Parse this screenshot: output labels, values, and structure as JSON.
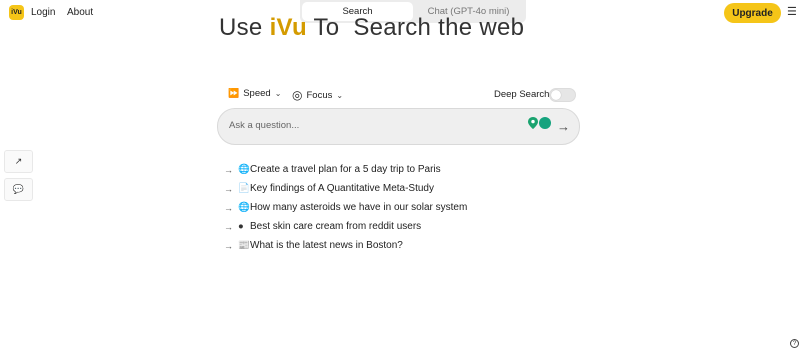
{
  "header": {
    "logo_text": "iVu",
    "nav": [
      "Login",
      "About"
    ],
    "upgrade_label": "Upgrade",
    "menu_icon": "hamburger-icon"
  },
  "tabs": [
    {
      "label": "Search",
      "active": true
    },
    {
      "label": "Chat (GPT-4o mini)",
      "active": false
    }
  ],
  "headline": {
    "prefix": "Use ",
    "brand": "iVu",
    "suffix": " To  Search the web"
  },
  "options": {
    "speed_label": "Speed",
    "focus_label": "Focus",
    "deep_search_label": "Deep Search",
    "deep_search_on": false
  },
  "search": {
    "placeholder": "Ask a question...",
    "value": ""
  },
  "suggestions": [
    {
      "icon": "globe-icon",
      "glyph": "🌐",
      "text": "Create a travel plan for a 5 day trip to Paris"
    },
    {
      "icon": "document-icon",
      "glyph": "📄",
      "text": "Key findings of A Quantitative Meta-Study"
    },
    {
      "icon": "globe-icon",
      "glyph": "🌐",
      "text": "How many asteroids we have in our solar system"
    },
    {
      "icon": "reddit-icon",
      "glyph": "●",
      "text": "Best skin care cream from reddit users"
    },
    {
      "icon": "newspaper-icon",
      "glyph": "📰",
      "text": "What is the latest news in Boston?"
    }
  ],
  "colors": {
    "accent": "#f5c518",
    "brand_text": "#d49b00",
    "speed_icon": "#1aa36f",
    "grammarly_icon": "#15a37e"
  }
}
